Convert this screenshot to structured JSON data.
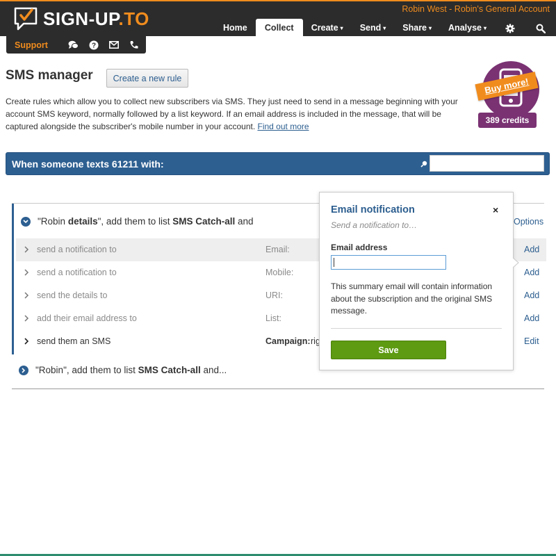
{
  "brand": {
    "logo_text_main": "SIGN-UP",
    "logo_text_accent": ".TO",
    "orange": "#f08c1e",
    "dark": "#2c2c2c",
    "blue": "#2d5f91",
    "purple": "#7a3273",
    "green": "#5e9a12"
  },
  "header": {
    "account": "Robin West - Robin's General Account",
    "nav": [
      {
        "label": "Home",
        "has_caret": false
      },
      {
        "label": "Collect",
        "active": true,
        "has_caret": false
      },
      {
        "label": "Create",
        "has_caret": true
      },
      {
        "label": "Send",
        "has_caret": true
      },
      {
        "label": "Share",
        "has_caret": true
      },
      {
        "label": "Analyse",
        "has_caret": true
      }
    ],
    "nav_icons": [
      "gear-icon",
      "search-icon"
    ],
    "caret": "▾"
  },
  "support": {
    "label": "Support",
    "icons": [
      "chat-icon",
      "help-icon",
      "mail-icon",
      "phone-icon"
    ]
  },
  "page": {
    "title": "SMS manager",
    "new_rule_button": "Create a new rule",
    "intro_text": "Create rules which allow you to collect new subscribers via SMS. They just need to send in a message beginning with your account SMS keyword, normally followed by a list keyword. If an email address is included in the message, that will be captured alongside the subscriber's mobile number in your account.",
    "intro_link": "Find out more"
  },
  "credits": {
    "buy_more": "Buy more!",
    "count": "389 credits",
    "icon": "mobile-phone-icon"
  },
  "text_bar": {
    "label": "When someone texts 61211 with:",
    "search_value": ""
  },
  "rule1": {
    "quote_open": "\"Robin ",
    "keyword": "details",
    "middle": "\", add them to list ",
    "list": "SMS Catch-all",
    "end": " and",
    "options": "Options",
    "rows": [
      {
        "action": "send a notification to",
        "field": "Email:",
        "value": "",
        "link": "Add"
      },
      {
        "action": "send a notification to",
        "field": "Mobile:",
        "value": "",
        "link": "Add"
      },
      {
        "action": "send the details to",
        "field": "URI:",
        "value": "",
        "link": "Add"
      },
      {
        "action": "add their email address to",
        "field": "List:",
        "value": "",
        "link": "Add"
      },
      {
        "action": "send them an SMS",
        "field": "Campaign:",
        "value": "rig",
        "link": "Edit"
      }
    ]
  },
  "rule2": {
    "quote_open": "\"Robin",
    "middle": "\", add them to list ",
    "list": "SMS Catch-all",
    "end": " and..."
  },
  "popover": {
    "title": "Email notification",
    "close": "×",
    "subtitle": "Send a notification to…",
    "field_label": "Email address",
    "field_value": "",
    "note": "This summary email will contain information about the subscription and the original SMS message.",
    "save": "Save"
  }
}
